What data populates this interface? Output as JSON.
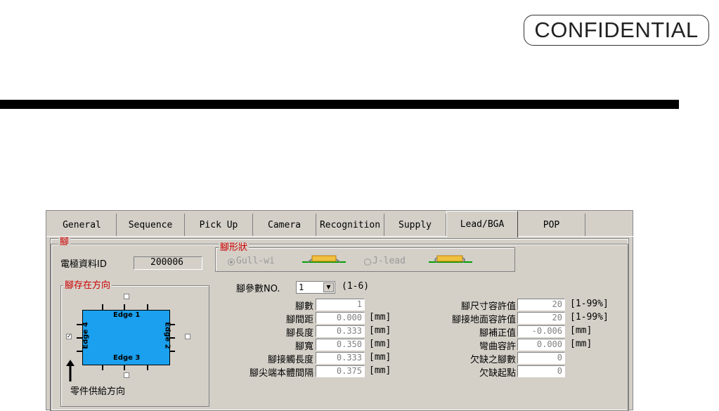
{
  "confidential": "CONFIDENTIAL",
  "tabs": [
    "General",
    "Sequence",
    "Pick Up",
    "Camera",
    "Recognition",
    "Supply",
    "Lead/BGA",
    "POP"
  ],
  "panel": {
    "group_title": "腳",
    "component_id_label": "電極資料ID",
    "component_id_value": "200006",
    "lead_shape": {
      "title": "腳形狀",
      "options": [
        "Gull-wi",
        "J-lead"
      ],
      "selected": "Gull-wi"
    },
    "direction": {
      "title": "腳存在方向",
      "edges": [
        "Edge 1",
        "Edge 2",
        "Edge 3",
        "Edge 4"
      ],
      "supply_label": "零件供給方向",
      "edge4_checked": true
    },
    "param_no": {
      "label": "腳參數NO.",
      "value": "1",
      "range": "(1-6)"
    },
    "left_fields": [
      {
        "label": "腳數",
        "value": "1",
        "unit": ""
      },
      {
        "label": "腳間距",
        "value": "0.000",
        "unit": "[mm]"
      },
      {
        "label": "腳長度",
        "value": "0.333",
        "unit": "[mm]"
      },
      {
        "label": "腳寬",
        "value": "0.350",
        "unit": "[mm]"
      },
      {
        "label": "腳接觸長度",
        "value": "0.333",
        "unit": "[mm]"
      },
      {
        "label": "腳尖端本體間隔",
        "value": "0.375",
        "unit": "[mm]"
      }
    ],
    "right_fields": [
      {
        "label": "腳尺寸容許值",
        "value": "20",
        "unit": "[1-99%]"
      },
      {
        "label": "腳接地面容許值",
        "value": "20",
        "unit": "[1-99%]"
      },
      {
        "label": "腳補正值",
        "value": "-0.006",
        "unit": "[mm]"
      },
      {
        "label": "彎曲容許",
        "value": "0.000",
        "unit": "[mm]"
      },
      {
        "label": "欠缺之腳數",
        "value": "0",
        "unit": ""
      },
      {
        "label": "欠缺起點",
        "value": "0",
        "unit": ""
      }
    ]
  },
  "colors": {
    "accent_red": "#cc0000",
    "component_blue": "#1aa0ee",
    "window_gray": "#d4d0c8"
  }
}
